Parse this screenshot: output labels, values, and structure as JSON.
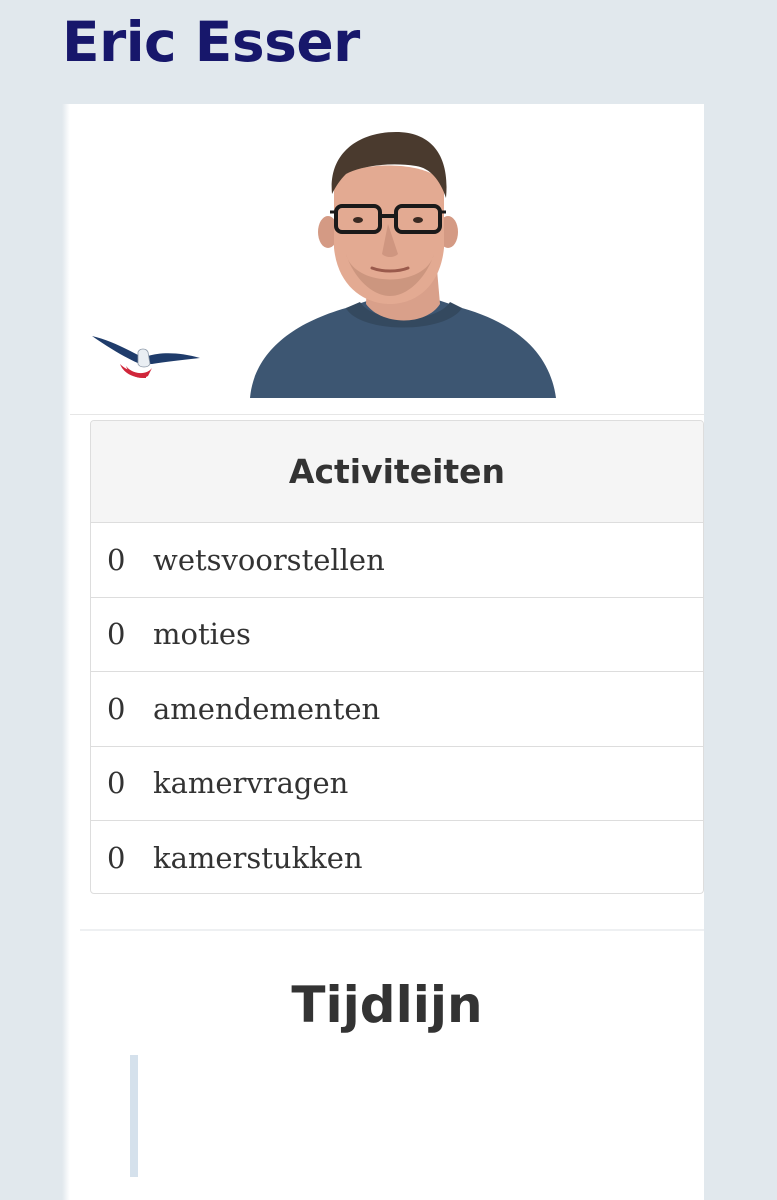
{
  "profile": {
    "name": "Eric Esser"
  },
  "activities": {
    "title": "Activiteiten",
    "items": [
      {
        "count": "0",
        "label": "wetsvoorstellen"
      },
      {
        "count": "0",
        "label": "moties"
      },
      {
        "count": "0",
        "label": "amendementen"
      },
      {
        "count": "0",
        "label": "kamervragen"
      },
      {
        "count": "0",
        "label": "kamerstukken"
      }
    ]
  },
  "timeline": {
    "title": "Tijdlijn"
  },
  "colors": {
    "page_background": "#e1e8ed",
    "title_color": "#17176b",
    "timeline_accent": "#d5e1ec",
    "logo_blue": "#1f3c6b",
    "logo_red": "#d0263a"
  },
  "icons": {
    "party_logo": "bird-logo-icon",
    "portrait": "portrait-photo"
  }
}
